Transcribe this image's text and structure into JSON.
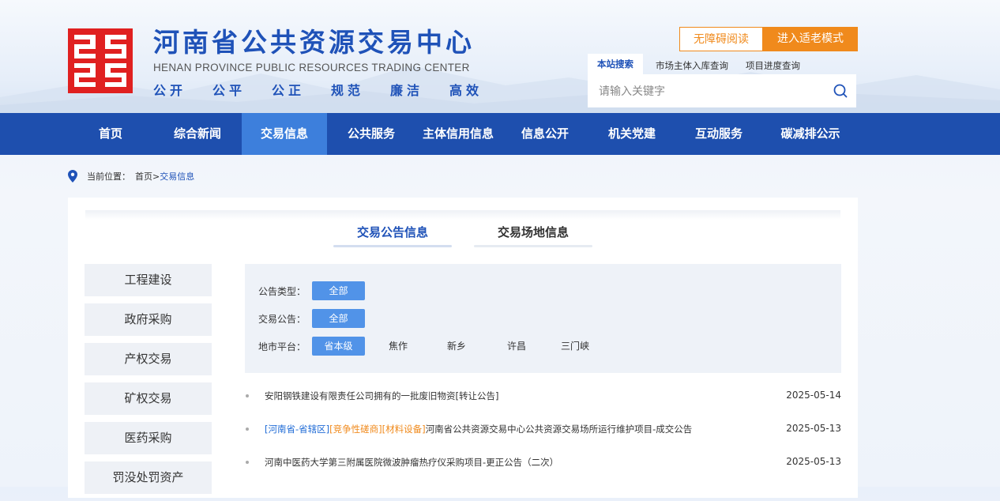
{
  "header": {
    "title_cn": "河南省公共资源交易中心",
    "title_en": "HENAN PROVINCE PUBLIC RESOURCES TRADING CENTER",
    "slogans": [
      "公开",
      "公平",
      "公正",
      "规范",
      "廉洁",
      "高效"
    ],
    "accessibility_label": "无障碍阅读",
    "elder_mode_label": "进入适老模式",
    "search_tabs": [
      "本站搜索",
      "市场主体入库查询",
      "项目进度查询"
    ],
    "search_placeholder": "请输入关键字",
    "brand_color": "#1e4fae",
    "logo_color": "#e02020",
    "accent_color": "#f08a1c"
  },
  "nav": {
    "items": [
      "首页",
      "综合新闻",
      "交易信息",
      "公共服务",
      "主体信用信息",
      "信息公开",
      "机关党建",
      "互动服务",
      "碳减排公示"
    ],
    "active_index": 2
  },
  "breadcrumb": {
    "label": "当前位置：",
    "home": "首页>",
    "current": "交易信息"
  },
  "tabs": [
    "交易公告信息",
    "交易场地信息"
  ],
  "sidebar": [
    "工程建设",
    "政府采购",
    "产权交易",
    "矿权交易",
    "医药采购",
    "罚没处罚资产"
  ],
  "filters": {
    "notice_type": {
      "label": "公告类型：",
      "value": "全部"
    },
    "trade_notice": {
      "label": "交易公告：",
      "value": "全部"
    },
    "platform": {
      "label": "地市平台：",
      "options": [
        "省本级",
        "焦作",
        "新乡",
        "许昌",
        "三门峡"
      ]
    }
  },
  "list": [
    {
      "title": "安阳钢铁建设有限责任公司拥有的一批废旧物资[转让公告]",
      "date": "2025-05-14"
    },
    {
      "tag1": "[河南省-省辖区]",
      "tag2": "[竞争性磋商]",
      "tag3": "[材料设备]",
      "title": "河南省公共资源交易中心公共资源交易场所运行维护项目-成交公告",
      "date": "2025-05-13"
    },
    {
      "title": "河南中医药大学第三附属医院微波肿瘤热疗仪采购项目-更正公告（二次）",
      "date": "2025-05-13"
    }
  ]
}
